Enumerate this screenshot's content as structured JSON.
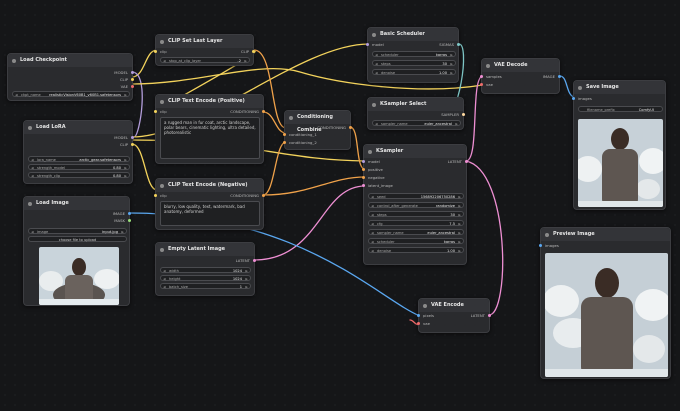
{
  "colors": {
    "model": "#b39ddb",
    "clip": "#f3d35c",
    "vae": "#ef6b6b",
    "conditioning": "#f0a24a",
    "latent": "#ee8fd3",
    "image": "#5aa7f0",
    "sigmas": "#7fc8c8",
    "sampler": "#ffd9a0",
    "int": "#9ae07a"
  },
  "nodes": {
    "load_checkpoint": {
      "title": "Load Checkpoint",
      "out_model": "MODEL",
      "out_clip": "CLIP",
      "out_vae": "VAE",
      "w_name": "ckpt_name",
      "w_value": "realisticVisionV60B1_v60B1.safetensors"
    },
    "clip_set_last_layer": {
      "title": "CLIP Set Last Layer",
      "in_clip": "clip",
      "out_clip": "CLIP",
      "w_name": "stop_at_clip_layer",
      "w_value": "-2"
    },
    "clip_text_pos": {
      "title": "CLIP Text Encode (Positive)",
      "in_clip": "clip",
      "out": "CONDITIONING",
      "text": "a rugged man in fur coat, arctic landscape, polar bears, cinematic lighting, ultra detailed, photorealistic"
    },
    "load_lora": {
      "title": "Load LoRA",
      "in_model": "model",
      "in_clip": "clip",
      "out_model": "MODEL",
      "out_clip": "CLIP",
      "w1n": "lora_name",
      "w1v": "arctic_gear.safetensors",
      "w2n": "strength_model",
      "w2v": "0.80",
      "w3n": "strength_clip",
      "w3v": "0.80"
    },
    "clip_text_neg": {
      "title": "CLIP Text Encode (Negative)",
      "in_clip": "clip",
      "out": "CONDITIONING",
      "text": "blurry, low quality, text, watermark, bad anatomy, deformed"
    },
    "load_image": {
      "title": "Load Image",
      "out_image": "IMAGE",
      "out_mask": "MASK",
      "w_name": "image",
      "w_value": "input.jpg",
      "button": "choose file to upload"
    },
    "empty_latent": {
      "title": "Empty Latent Image",
      "out": "LATENT",
      "w1n": "width",
      "w1v": "1024",
      "w2n": "height",
      "w2v": "1024",
      "w3n": "batch_size",
      "w3v": "1"
    },
    "conditioning_combine": {
      "title": "Conditioning Combine",
      "in1": "conditioning_1",
      "in2": "conditioning_2",
      "out": "CONDITIONING"
    },
    "basic_scheduler": {
      "title": "Basic Scheduler",
      "in_model": "model",
      "out": "SIGMAS",
      "w1n": "scheduler",
      "w1v": "karras",
      "w2n": "steps",
      "w2v": "30",
      "w3n": "denoise",
      "w3v": "1.00"
    },
    "ksampler_select": {
      "title": "KSampler Select",
      "out": "SAMPLER",
      "w_name": "sampler_name",
      "w_value": "euler_ancestral"
    },
    "ksampler": {
      "title": "KSampler",
      "in_model": "model",
      "in_pos": "positive",
      "in_neg": "negative",
      "in_latent": "latent_image",
      "out": "LATENT",
      "widgets": [
        [
          "seed",
          "156892206750286"
        ],
        [
          "control_after_generate",
          "randomize"
        ],
        [
          "steps",
          "30"
        ],
        [
          "cfg",
          "7.5"
        ],
        [
          "sampler_name",
          "euler_ancestral"
        ],
        [
          "scheduler",
          "karras"
        ],
        [
          "denoise",
          "1.00"
        ]
      ]
    },
    "vae_decode": {
      "title": "VAE Decode",
      "in_samples": "samples",
      "in_vae": "vae",
      "out": "IMAGE"
    },
    "save_image": {
      "title": "Save Image",
      "in_images": "images",
      "w_name": "filename_prefix",
      "w_value": "ComfyUI"
    },
    "preview_image": {
      "title": "Preview Image",
      "in_images": "images"
    },
    "vae_encode": {
      "title": "VAE Encode",
      "in_pixels": "pixels",
      "in_vae": "vae",
      "out": "LATENT"
    }
  }
}
